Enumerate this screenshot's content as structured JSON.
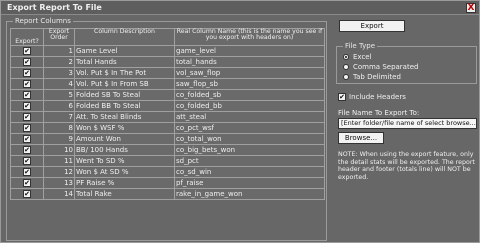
{
  "window": {
    "title": "Export Report To File",
    "close_label": "X"
  },
  "report_columns": {
    "group_label": "Report Columns",
    "headers": {
      "export": "Export?",
      "order": "Export Order",
      "description": "Column Description",
      "real_name": "Real Column Name (this is the name you see if you export with headers on)"
    },
    "rows": [
      {
        "export": true,
        "order": "1",
        "description": "Game Level",
        "real_name": "game_level"
      },
      {
        "export": true,
        "order": "2",
        "description": "Total Hands",
        "real_name": "total_hands"
      },
      {
        "export": true,
        "order": "3",
        "description": "Vol. Put $ In The Pot",
        "real_name": "vol_saw_flop"
      },
      {
        "export": true,
        "order": "4",
        "description": "Vol. Put $ In From SB",
        "real_name": "saw_flop_sb"
      },
      {
        "export": true,
        "order": "5",
        "description": "Folded SB To Steal",
        "real_name": "co_folded_sb"
      },
      {
        "export": true,
        "order": "6",
        "description": "Folded BB To Steal",
        "real_name": "co_folded_bb"
      },
      {
        "export": true,
        "order": "7",
        "description": "Att. To Steal Blinds",
        "real_name": "att_steal"
      },
      {
        "export": true,
        "order": "8",
        "description": "Won $ WSF %",
        "real_name": "co_pct_wsf"
      },
      {
        "export": true,
        "order": "9",
        "description": "Amount Won",
        "real_name": "co_total_won"
      },
      {
        "export": true,
        "order": "10",
        "description": "BB/ 100 Hands",
        "real_name": "co_big_bets_won"
      },
      {
        "export": true,
        "order": "11",
        "description": "Went To SD %",
        "real_name": "sd_pct"
      },
      {
        "export": true,
        "order": "12",
        "description": "Won $ At SD %",
        "real_name": "co_sd_win"
      },
      {
        "export": true,
        "order": "13",
        "description": "PF Raise %",
        "real_name": "pf_raise"
      },
      {
        "export": true,
        "order": "14",
        "description": "Total Rake",
        "real_name": "rake_in_game_won"
      }
    ]
  },
  "export_button": {
    "label": "Export"
  },
  "file_type": {
    "group_label": "File Type",
    "options": [
      {
        "label": "Excel",
        "selected": true
      },
      {
        "label": "Comma Separated",
        "selected": false
      },
      {
        "label": "Tab Delimited",
        "selected": false
      }
    ]
  },
  "include_headers": {
    "label": "Include Headers",
    "checked": true
  },
  "file_name": {
    "label": "File Name To Export To:",
    "value": "[Enter folder/file name of select browse...]"
  },
  "browse_button": {
    "label": "Browse..."
  },
  "note": "NOTE: When using the export feature, only the detail stats will be exported. The report header and footer (totals line) will NOT be exported."
}
